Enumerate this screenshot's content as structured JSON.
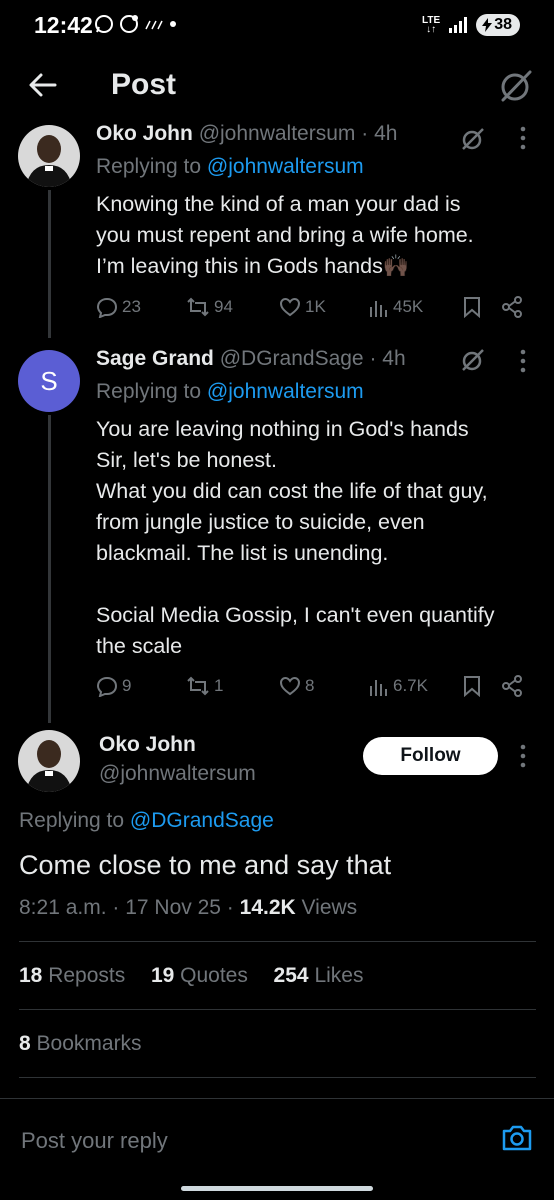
{
  "status": {
    "time": "12:42",
    "network": "LTE",
    "battery": "38"
  },
  "header": {
    "title": "Post"
  },
  "replies": [
    {
      "name": "Oko John",
      "handle": "@johnwaltersum",
      "age": "· 4h",
      "replying_prefix": "Replying to",
      "replying_to": "@johnwaltersum",
      "lines": [
        "Knowing the kind of a man your dad is",
        "you must repent and bring a wife home.",
        "I’m leaving this in Gods hands🙌🏿"
      ],
      "stats": {
        "replies": "23",
        "reposts": "94",
        "likes": "1K",
        "views": "45K"
      }
    },
    {
      "name": "Sage Grand",
      "handle": "@DGrandSage",
      "age": "· 4h",
      "avatar_letter": "S",
      "replying_prefix": "Replying to",
      "replying_to": "@johnwaltersum",
      "lines": [
        "You are leaving nothing in God's hands",
        "Sir, let's be honest.",
        "What you did can cost the life of that guy,",
        "from jungle justice to suicide, even",
        "blackmail. The list is unending.",
        "",
        "Social Media Gossip, I can't even quantify",
        "the scale"
      ],
      "stats": {
        "replies": "9",
        "reposts": "1",
        "likes": "8",
        "views": "6.7K"
      }
    }
  ],
  "main_post": {
    "name": "Oko John",
    "handle": "@johnwaltersum",
    "follow_label": "Follow",
    "replying_prefix": "Replying to",
    "replying_to": "@DGrandSage",
    "text": "Come close to me and say that",
    "time": "8:21 a.m.",
    "date": "17 Nov 25",
    "views_count": "14.2K",
    "views_label": "Views",
    "reposts_count": "18",
    "reposts_label": "Reposts",
    "quotes_count": "19",
    "quotes_label": "Quotes",
    "likes_count": "254",
    "likes_label": "Likes",
    "bookmarks_count": "8",
    "bookmarks_label": "Bookmarks"
  },
  "reply_bar": {
    "placeholder": "Post your reply"
  },
  "colors": {
    "accent": "#1d9bf0",
    "muted": "#71767b",
    "sage_avatar": "#5b5ed4"
  }
}
